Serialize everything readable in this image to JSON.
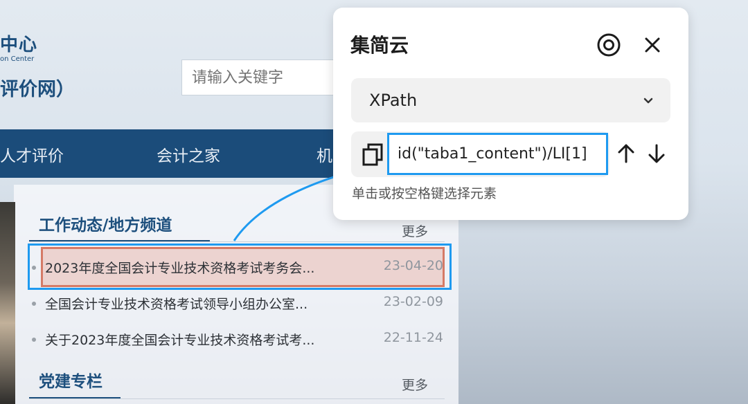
{
  "site": {
    "logo_title": "中心",
    "logo_sub": "on Center",
    "logo_net": "评价网）",
    "search_placeholder": "请输入关键字",
    "nav": [
      "人才评价",
      "会计之家",
      "机"
    ],
    "section1": {
      "title": "工作动态/地方频道",
      "more": "更多",
      "items": [
        {
          "title": "2023年度全国会计专业技术资格考试考务会...",
          "date": "23-04-20"
        },
        {
          "title": "全国会计专业技术资格考试领导小组办公室...",
          "date": "23-02-09"
        },
        {
          "title": "关于2023年度全国会计专业技术资格考试考...",
          "date": "22-11-24"
        }
      ]
    },
    "section2": {
      "title": "党建专栏",
      "more": "更多"
    }
  },
  "popup": {
    "title": "集简云",
    "icons": {
      "view": "eye-icon",
      "close": "close-icon",
      "copy": "copy-icon",
      "up": "arrow-up-icon",
      "down": "arrow-down-icon",
      "dropdown": "chevron-down-icon"
    },
    "selector_type": "XPath",
    "xpath_value": "id(\"taba1_content\")/LI[1]",
    "hint": "单击或按空格键选择元素"
  },
  "colors": {
    "accent": "#1e9af0",
    "brand_blue": "#1b4c7a",
    "highlight_border": "#d57a66"
  }
}
